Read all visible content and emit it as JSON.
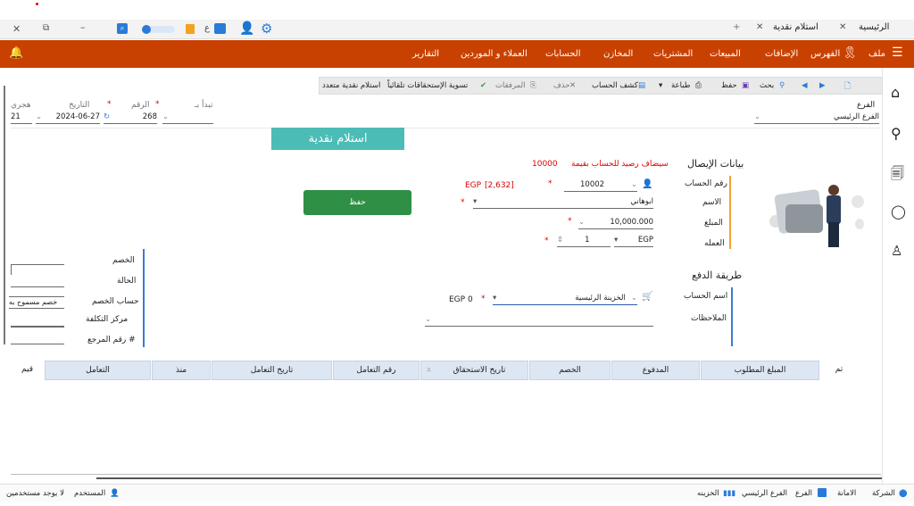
{
  "tabs": [
    {
      "label": "الرئيسية"
    },
    {
      "label": "استلام نقدية"
    },
    {
      "label": "+"
    }
  ],
  "menu": {
    "items": [
      "ملف",
      "الفهرس",
      "الإضافات",
      "المبيعات",
      "المشتريات",
      "المخازن",
      "الحسابات",
      "العملاء و الموردين",
      "التقارير"
    ]
  },
  "toolbar": {
    "search": "بحث",
    "save": "حفظ",
    "print": "طباعة",
    "statement": "كشف الحساب",
    "delete": "حذف",
    "attachments": "المرفقات",
    "auto_settle": "تسوية الإستحقاقات تلقائياً",
    "multi_receipt": "استلام نقدية متعدد"
  },
  "header_fields": {
    "branch_label": "الفرع",
    "branch_value": "الفرع الرئيسي",
    "starts_with_label": "تبدأ بـ",
    "number_label": "الرقم",
    "number_value": "268",
    "date_label": "التاريخ",
    "date_value": "2024-06-27",
    "hijri_label": "هجري",
    "hijri_value": "21"
  },
  "page_title": "استلام نقدية",
  "save_button": "حفظ",
  "receipt": {
    "section_title": "بيانات الإيصال",
    "balance_note": "سيضاف رصيد للحساب بقيمة",
    "balance_amount": "10000",
    "account_no_label": "رقم الحساب",
    "account_no_value": "10002",
    "account_balance": "[2,632]",
    "account_currency": "EGP",
    "name_label": "الاسم",
    "name_value": "ابوهاني",
    "amount_label": "المبلغ",
    "amount_value": "10,000.000",
    "currency_label": "العمله",
    "currency_rate": "1",
    "currency_value": "EGP"
  },
  "payment": {
    "section_title": "طريقة الدفع",
    "account_name_label": "اسم الحساب",
    "account_name_value": "الخزينة الرئيسية",
    "account_balance": "0",
    "account_currency": "EGP",
    "notes_label": "الملاحظات"
  },
  "discount": {
    "discount_label": "الخصم",
    "status_label": "الحالة",
    "discount_account_label": "حساب الخصم",
    "discount_account_value": "خصم مسموح به",
    "cost_center_label": "مركز التكلفة",
    "ref_no_label": "رقم المرجع #"
  },
  "grid": {
    "columns": [
      "تم",
      "المبلغ المطلوب",
      "المدفوع",
      "الخصم",
      "تاريخ الاستحقاق",
      "رقم التعامل",
      "تاريخ التعامل",
      "منذ",
      "التعامل",
      "قيم"
    ]
  },
  "status": {
    "company": "الشركة",
    "trust": "الامانة",
    "branch": "الفرع",
    "branch_value": "الفرع الرئيسي",
    "treasury": "الخزينه",
    "user": "المستخدم",
    "no_users": "لا يوجد مستخدمين"
  },
  "colors": {
    "menu_bar": "#c94100",
    "title_box": "#4cbcb6",
    "save_button": "#2f8f45",
    "required": "#e00000"
  }
}
